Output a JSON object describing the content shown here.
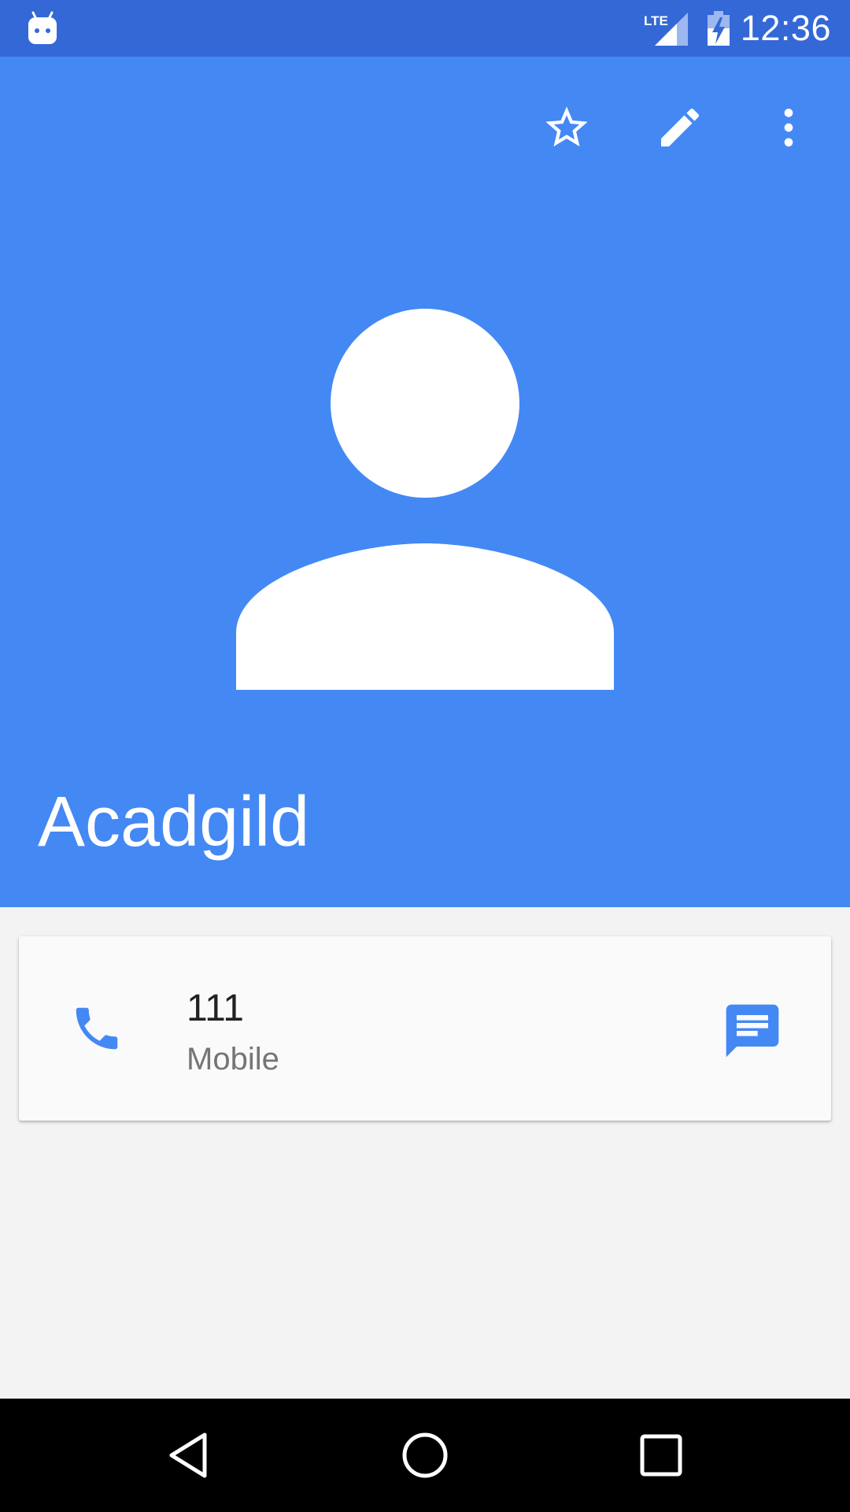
{
  "status_bar": {
    "time": "12:36",
    "network_label": "LTE",
    "icons": [
      "android-icon",
      "lte-signal-icon",
      "battery-charging-icon"
    ]
  },
  "header": {
    "contact_name": "Acadgild",
    "actions": [
      "star-icon",
      "edit-icon",
      "more-vert-icon"
    ],
    "background_color": "#4488F4"
  },
  "phone_card": {
    "number": "111",
    "type": "Mobile",
    "icons": [
      "phone-icon",
      "message-icon"
    ],
    "accent_color": "#4488F4"
  },
  "nav_bar": {
    "buttons": [
      "back-icon",
      "home-icon",
      "recents-icon"
    ]
  }
}
